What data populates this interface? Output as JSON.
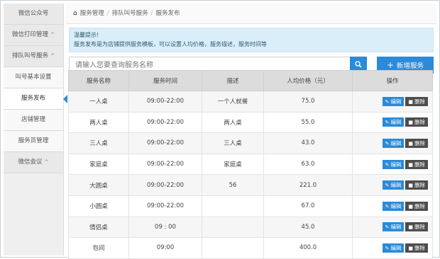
{
  "sidebar": {
    "items": [
      {
        "label": "微信公众号",
        "chev": ""
      },
      {
        "label": "微信打印管理",
        "chev": "^"
      },
      {
        "label": "排队叫号服务",
        "chev": "^"
      },
      {
        "label": "叫号基本设置",
        "chev": ""
      },
      {
        "label": "服务发布",
        "chev": ""
      },
      {
        "label": "店铺管理",
        "chev": ""
      },
      {
        "label": "服务员管理",
        "chev": ""
      },
      {
        "label": "微信会议",
        "chev": "^"
      }
    ]
  },
  "breadcrumb": {
    "home": "服务管理",
    "mid": "排队叫号服务",
    "current": "服务发布",
    "sep": "/"
  },
  "alert": {
    "title": "温馨提示!",
    "body": "服务发布是为店铺提供服务模板，可以设置人均价格，服务描述，服务时间等"
  },
  "search": {
    "placeholder": "请输入您要查询服务名称"
  },
  "add_button": {
    "label": "新增服务"
  },
  "table": {
    "headers": [
      "服务名称",
      "服务时间",
      "描述",
      "人均价格（元）",
      "操作"
    ],
    "edit_label": "编辑",
    "delete_label": "删除",
    "rows": [
      {
        "name": "一人桌",
        "time": "09:00-22:00",
        "desc": "一个人就餐",
        "price": "75.0"
      },
      {
        "name": "两人桌",
        "time": "09:00-22:00",
        "desc": "两人桌",
        "price": "55.0"
      },
      {
        "name": "三人桌",
        "time": "09:00-22:00",
        "desc": "三人桌",
        "price": "43.0"
      },
      {
        "name": "家庭桌",
        "time": "09:00-22:00",
        "desc": "家庭桌",
        "price": "63.0"
      },
      {
        "name": "大圆桌",
        "time": "09:00-22:00",
        "desc": "56",
        "price": "221.0"
      },
      {
        "name": "小圆桌",
        "time": "09:00-22:00",
        "desc": "",
        "price": "67.0"
      },
      {
        "name": "情侣桌",
        "time": "09 : 00",
        "desc": "",
        "price": "45.0"
      },
      {
        "name": "包间",
        "time": "09:00",
        "desc": "",
        "price": "400.0"
      }
    ]
  },
  "colors": {
    "accent": "#2b8ad9",
    "delete": "#4d4d4d",
    "alert_bg": "#daeef9"
  }
}
